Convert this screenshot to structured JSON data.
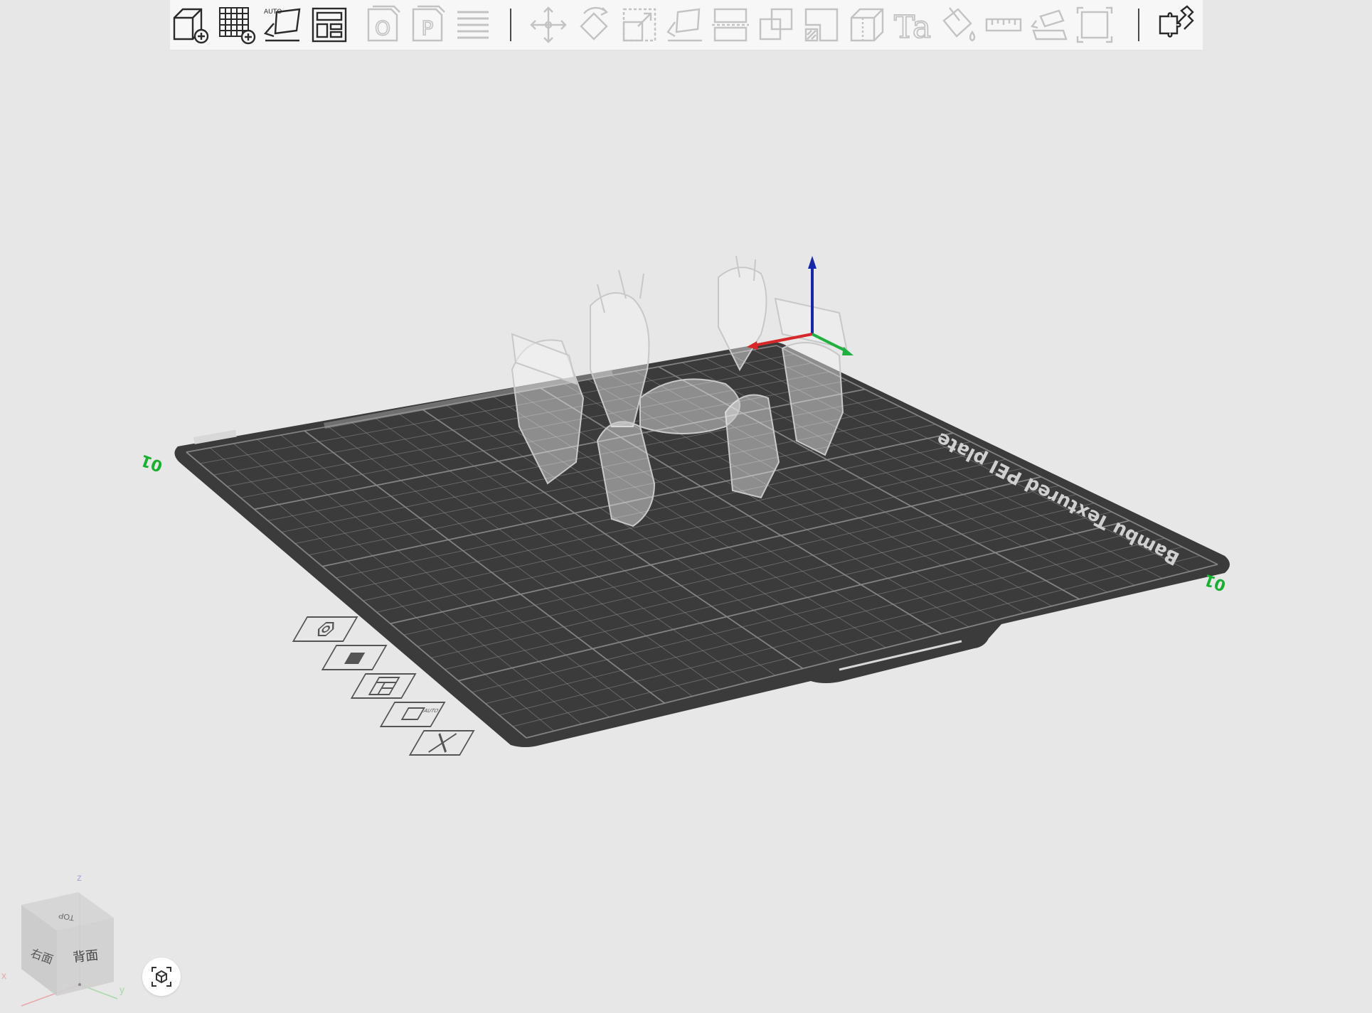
{
  "toolbar": {
    "items": [
      {
        "name": "add-object-button",
        "icon": "cube-plus-icon",
        "enabled": true
      },
      {
        "name": "add-plate-button",
        "icon": "grid-plus-icon",
        "enabled": true
      },
      {
        "name": "auto-orient-button",
        "icon": "auto-orient-icon",
        "label": "AUTO",
        "enabled": true
      },
      {
        "name": "arrange-button",
        "icon": "arrange-icon",
        "enabled": true
      },
      {
        "name": "split-to-objects-button",
        "icon": "split-objects-icon",
        "label": "O",
        "enabled": false
      },
      {
        "name": "split-to-parts-button",
        "icon": "split-parts-icon",
        "label": "P",
        "enabled": false
      },
      {
        "name": "variable-layer-height-button",
        "icon": "layers-icon",
        "enabled": false
      },
      {
        "name": "move-button",
        "icon": "move-icon",
        "enabled": false
      },
      {
        "name": "rotate-button",
        "icon": "rotate-icon",
        "enabled": false
      },
      {
        "name": "scale-button",
        "icon": "scale-icon",
        "enabled": false
      },
      {
        "name": "lay-on-face-button",
        "icon": "lay-on-face-icon",
        "enabled": false
      },
      {
        "name": "cut-button",
        "icon": "cut-icon",
        "enabled": false
      },
      {
        "name": "mesh-boolean-button",
        "icon": "boolean-icon",
        "enabled": false
      },
      {
        "name": "support-painting-button",
        "icon": "support-paint-icon",
        "enabled": false
      },
      {
        "name": "seam-painting-button",
        "icon": "seam-paint-icon",
        "enabled": false
      },
      {
        "name": "text-shape-button",
        "icon": "text-shape-icon",
        "label": "Ta",
        "enabled": false
      },
      {
        "name": "color-painting-button",
        "icon": "paint-bucket-icon",
        "enabled": false
      },
      {
        "name": "measure-button",
        "icon": "ruler-icon",
        "enabled": false
      },
      {
        "name": "assembly-button",
        "icon": "assembly-icon",
        "enabled": false
      },
      {
        "name": "fit-view-button",
        "icon": "fit-view-icon",
        "enabled": false
      },
      {
        "name": "plugins-button",
        "icon": "puzzle-icon",
        "enabled": true
      }
    ]
  },
  "plate": {
    "label": "Bambu Textured PEI plate",
    "corner_labels": [
      "01",
      "01"
    ],
    "tools": [
      {
        "name": "plate-settings-button",
        "icon": "hexagon-icon"
      },
      {
        "name": "plate-lock-button",
        "icon": "lock-icon"
      },
      {
        "name": "plate-arrange-button",
        "icon": "arrange-icon"
      },
      {
        "name": "plate-auto-orient-button",
        "icon": "auto-orient-icon",
        "label": "AUTO"
      },
      {
        "name": "delete-plate-button",
        "icon": "close-icon"
      }
    ]
  },
  "view_cube": {
    "faces": [
      "TOP",
      "右面",
      "背面"
    ],
    "axes": [
      "x",
      "y",
      "z"
    ]
  },
  "colors": {
    "background": "#e7e7e7",
    "bed": "#3a3b3a",
    "grid": "#8a8b8a",
    "axis_x": "#d62828",
    "axis_y": "#20b040",
    "axis_z": "#1628a8",
    "corner_label": "#18b030"
  }
}
